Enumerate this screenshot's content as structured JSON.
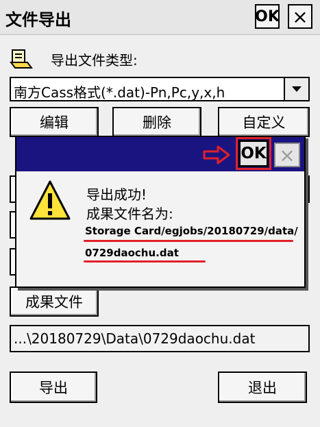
{
  "window": {
    "title": "文件导出",
    "ok_label": "OK",
    "close_label": "×"
  },
  "export_type": {
    "label": "导出文件类型:",
    "selected": "南方Cass格式(*.dat)-Pn,Pc,y,x,h"
  },
  "buttons": {
    "edit": "编辑",
    "delete": "删除",
    "custom": "自定义",
    "result_file": "成果文件",
    "export": "导出",
    "exit": "退出"
  },
  "result_path": "...\\20180729\\Data\\0729daochu.dat",
  "dialog": {
    "ok_label": "OK",
    "close_label": "×",
    "message_line1": "导出成功!",
    "message_line2": "成果文件名为:",
    "file_path_line1": "Storage Card/egjobs/20180729/data/",
    "file_path_line2": "0729daochu.dat"
  },
  "colors": {
    "dialog_titlebar": "#1a1480",
    "highlight_red": "#e0202a",
    "warning_yellow": "#ffe23a"
  }
}
